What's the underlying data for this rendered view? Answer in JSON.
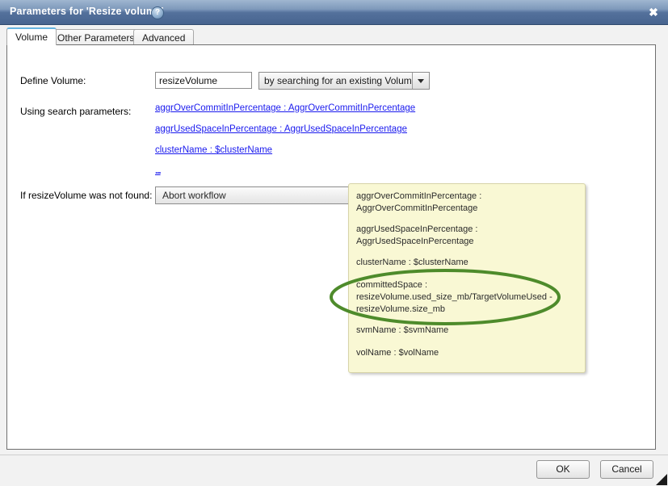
{
  "window": {
    "title": "Parameters for 'Resize volume'",
    "help_icon": "help-circle-icon",
    "close_icon": "✖"
  },
  "tabs": [
    {
      "label": "Volume",
      "active": true
    },
    {
      "label": "Other Parameters",
      "active": false
    },
    {
      "label": "Advanced",
      "active": false
    }
  ],
  "form": {
    "define_volume_label": "Define Volume:",
    "volume_name_value": "resizeVolume",
    "volume_name_placeholder": "",
    "define_method_value": "by searching for an existing Volume",
    "search_params_label": "Using search parameters:",
    "search_params": [
      "aggrOverCommitInPercentage  :   AggrOverCommitInPercentage",
      "aggrUsedSpaceInPercentage  :   AggrUsedSpaceInPercentage",
      "clusterName  :  $clusterName",
      "..."
    ],
    "not_found_label": "If resizeVolume was not found:",
    "not_found_value": "Abort workflow"
  },
  "tooltip": {
    "entries": [
      "aggrOverCommitInPercentage  :\nAggrOverCommitInPercentage",
      "aggrUsedSpaceInPercentage  :\nAggrUsedSpaceInPercentage",
      "clusterName  :  $clusterName",
      "committedSpace  :\nresizeVolume.used_size_mb/TargetVolumeUsed -\nresizeVolume.size_mb",
      "svmName  :  $svmName",
      "volName  :  $volName"
    ]
  },
  "annotation": {
    "shape": "ellipse",
    "color": "#4e8b2b",
    "target_entry_index": 3
  },
  "footer": {
    "ok_label": "OK",
    "cancel_label": "Cancel"
  },
  "colors": {
    "titlebar_start": "#9fb6d0",
    "titlebar_end": "#47648f",
    "link": "#1a1aee",
    "tooltip_bg": "#f9f8d4",
    "annotation_green": "#4e8b2b",
    "active_tab_accent": "#66b4e0"
  }
}
